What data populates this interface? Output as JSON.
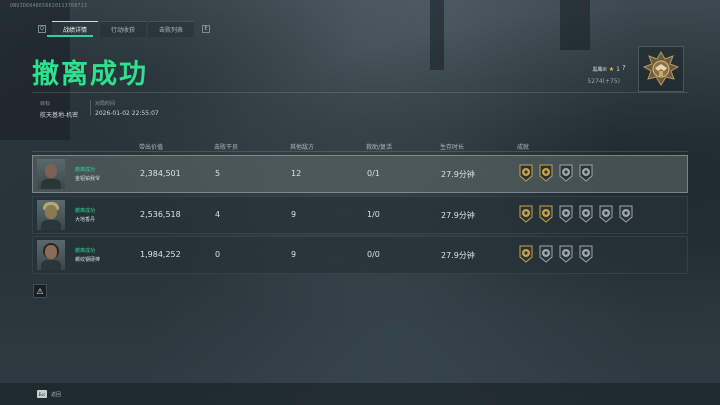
{
  "uid": "ONUID6048656620113768713",
  "tabs": {
    "left_key": "Q",
    "right_key": "E",
    "items": [
      {
        "label": "战绩详情",
        "active": true
      },
      {
        "label": "行动收获",
        "active": false
      },
      {
        "label": "击败列表",
        "active": false
      }
    ]
  },
  "title": "撤离成功",
  "rank": {
    "name": "黑鹰III",
    "count": "1",
    "score": "5274(+75)",
    "help": "?",
    "badge_icon": "rank-eagle-icon"
  },
  "meta": {
    "target_label": "目标",
    "target_value": "航天基地-机密",
    "time_label": "对局时间",
    "time_value": "2026-01-02 22:55:07"
  },
  "table": {
    "headers": [
      "带出价值",
      "击败干员",
      "其他敌方",
      "救助/复活",
      "生存时长",
      "成就"
    ],
    "rows": [
      {
        "status": "撤离成功",
        "name": "金铝铂我爷",
        "value": "2,384,501",
        "kills": "5",
        "others": "12",
        "rescue": "0/1",
        "survival": "27.9分钟",
        "highlight": true,
        "achievements": [
          "gold",
          "gold",
          "silver",
          "silver"
        ]
      },
      {
        "status": "撤离成功",
        "name": "大地香丹",
        "value": "2,536,518",
        "kills": "4",
        "others": "9",
        "rescue": "1/0",
        "survival": "27.9分钟",
        "highlight": false,
        "achievements": [
          "gold",
          "gold",
          "silver",
          "silver",
          "silver",
          "silver"
        ]
      },
      {
        "status": "撤离成功",
        "name": "螺纹钢硬棒",
        "value": "1,984,252",
        "kills": "0",
        "others": "9",
        "rescue": "0/0",
        "survival": "27.9分钟",
        "highlight": false,
        "achievements": [
          "gold",
          "silver",
          "silver",
          "silver"
        ]
      }
    ]
  },
  "footer": {
    "esc_key": "Esc",
    "back_label": "返回"
  },
  "colors": {
    "accent_green": "#2fe08f",
    "gold": "#c9a445",
    "silver": "#9ea7aa"
  }
}
